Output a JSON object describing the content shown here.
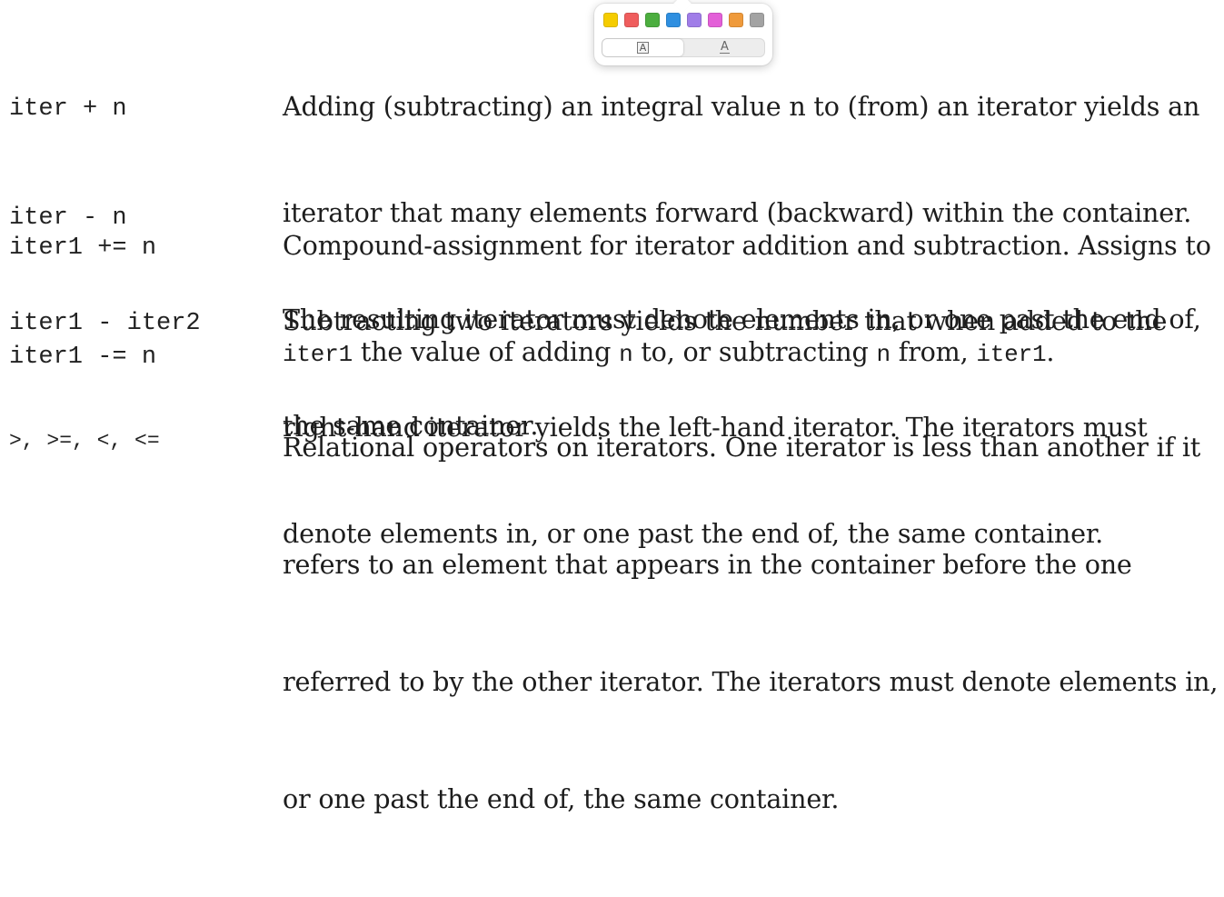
{
  "rows": [
    {
      "code": [
        "iter + n",
        "iter - n"
      ],
      "desc": [
        "Adding (subtracting) an integral value n to (from) an iterator yields an",
        "iterator that many elements forward (backward) within the container.",
        "The resulting iterator must denote elements in, or one past the end of,",
        "the same container."
      ]
    },
    {
      "code": [
        "iter1 += n",
        "iter1 -= n"
      ],
      "desc_line1": "Compound-assignment for iterator addition and subtraction. Assigns to",
      "desc_line2_parts": [
        "iter1",
        " the value of adding ",
        "n",
        " to, or subtracting ",
        "n",
        " from, ",
        "iter1",
        "."
      ]
    },
    {
      "code": [
        "iter1 - iter2"
      ],
      "desc": [
        "Subtracting two iterators yields the number that when added to the",
        "right-hand iterator yields the left-hand iterator. The iterators must",
        "denote elements in, or one past the end of, the same container."
      ]
    },
    {
      "code": [
        ">, >=, <, <="
      ],
      "desc": [
        "Relational operators on iterators. One iterator is less than another if it",
        "refers to an element that appears in the container before the one",
        "referred to by the other iterator. The iterators must denote elements in,",
        "or one past the end of, the same container."
      ]
    }
  ],
  "popover": {
    "colors": [
      {
        "name": "yellow",
        "hex": "#f5cc00"
      },
      {
        "name": "red",
        "hex": "#ef5d5d"
      },
      {
        "name": "green",
        "hex": "#4cae3f"
      },
      {
        "name": "blue",
        "hex": "#2f8fe0"
      },
      {
        "name": "purple",
        "hex": "#a07de8"
      },
      {
        "name": "pink",
        "hex": "#e35fd8"
      },
      {
        "name": "orange",
        "hex": "#ef9a3b"
      },
      {
        "name": "gray",
        "hex": "#a3a3a3"
      }
    ],
    "styles": [
      {
        "name": "highlight-style",
        "glyph": "A",
        "active": true
      },
      {
        "name": "underline-style",
        "glyph": "A",
        "active": false
      }
    ]
  }
}
